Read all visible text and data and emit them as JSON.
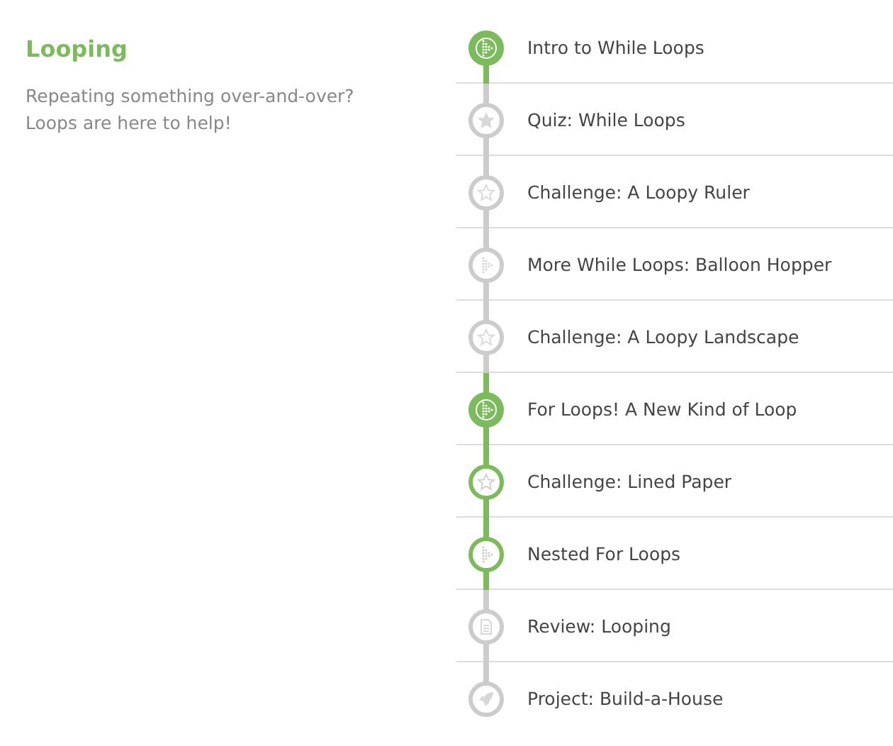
{
  "section": {
    "title": "Looping",
    "description": "Repeating something over-and-over? Loops are here to help!"
  },
  "lessons": [
    {
      "kind": "video",
      "complete": true,
      "started": true,
      "title": "Intro to While Loops"
    },
    {
      "kind": "quiz",
      "complete": false,
      "started": false,
      "title": "Quiz: While Loops"
    },
    {
      "kind": "challenge",
      "complete": false,
      "started": false,
      "title": "Challenge: A Loopy Ruler"
    },
    {
      "kind": "video",
      "complete": false,
      "started": false,
      "title": "More While Loops: Balloon Hopper"
    },
    {
      "kind": "challenge",
      "complete": false,
      "started": false,
      "title": "Challenge: A Loopy Landscape"
    },
    {
      "kind": "video",
      "complete": true,
      "started": true,
      "title": "For Loops! A New Kind of Loop"
    },
    {
      "kind": "challenge",
      "complete": false,
      "started": true,
      "title": "Challenge: Lined Paper"
    },
    {
      "kind": "video",
      "complete": false,
      "started": true,
      "title": "Nested For Loops"
    },
    {
      "kind": "review",
      "complete": false,
      "started": false,
      "title": "Review: Looping"
    },
    {
      "kind": "project",
      "complete": false,
      "started": false,
      "title": "Project: Build-a-House"
    }
  ]
}
